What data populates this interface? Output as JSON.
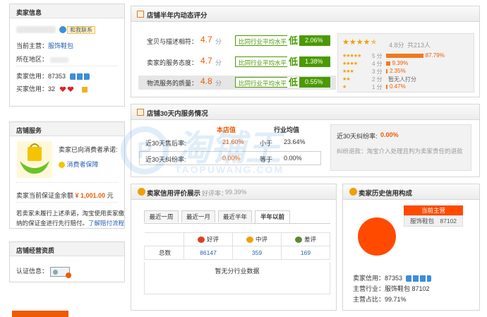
{
  "left": {
    "seller_info": {
      "title": "卖家信息",
      "contact_button": "和我联系",
      "main_business_label": "当前主营：",
      "main_business_value": "服饰鞋包",
      "location_label": "所在地区：",
      "seller_credit_label": "卖家信用：",
      "seller_credit_value": "87353",
      "buyer_credit_label": "买家信用：",
      "buyer_credit_value": "32"
    },
    "shop_service": {
      "title": "店铺服务",
      "promise_text": "卖家已向消费者承诺:",
      "guarantee_link": "消费者保障",
      "deposit_label": "卖家当前保证金余额",
      "deposit_value": "¥ 1,001.00",
      "deposit_unit": "元",
      "note_line1": "若卖家未履行上述承诺，淘宝使用卖家缴",
      "note_line2": "纳的保证金进行先行赔付。",
      "note_link": "了解赔付流程"
    },
    "qualification": {
      "title": "店铺经营资质",
      "cert_label": "认证信息："
    }
  },
  "dsr": {
    "title": "店铺半年内动态评分",
    "rows": [
      {
        "label": "宝贝与描述相符：",
        "score": "4.7",
        "unit": "分",
        "compare_label": "比同行业平均水平",
        "low": "低",
        "pct": "2.06%"
      },
      {
        "label": "卖家的服务态度：",
        "score": "4.7",
        "unit": "分",
        "compare_label": "比同行业平均水平",
        "low": "低",
        "pct": "1.38%"
      },
      {
        "label": "物流服务的质量：",
        "score": "4.8",
        "unit": "分",
        "compare_label": "比同行业平均水平",
        "low": "低",
        "pct": "0.55%"
      }
    ],
    "summary": {
      "score": "4.8分",
      "count": "共213人",
      "distribution": [
        {
          "label": "5 分",
          "pct": "87.79%",
          "fraction": 0.8779
        },
        {
          "label": "4 分",
          "pct": "9.39%",
          "fraction": 0.0939
        },
        {
          "label": "3 分",
          "pct": "2.35%",
          "fraction": 0.0235
        },
        {
          "label": "2 分",
          "pct": "暂无人打分",
          "fraction": 0
        },
        {
          "label": "1 分",
          "pct": "0.47%",
          "fraction": 0.0047
        }
      ]
    }
  },
  "service30": {
    "title": "店铺30天内服务情况",
    "col_shop": "本店值",
    "col_avg": "行业均值",
    "rows": [
      {
        "label": "近30天售后率:",
        "shop": "21.60%",
        "cmp": "小于",
        "avg": "23.64%"
      },
      {
        "label": "近30天纠纷率:",
        "shop": "0.00%",
        "cmp": "等于",
        "avg": "0.00%"
      }
    ],
    "dispute_title": "近30天纠纷率:",
    "dispute_value": "0.00%",
    "dispute_desc": "纠纷退款：淘宝介入处理且判为卖家责任的退款"
  },
  "credit": {
    "title": "卖家信用评价展示",
    "good_rate_label": "好评率：",
    "good_rate": "99.39%",
    "tabs": [
      "最近一周",
      "最近一月",
      "最近半年",
      "半年以前"
    ],
    "active_tab": 3,
    "headers": [
      "好评",
      "中评",
      "差评"
    ],
    "total_label": "总数",
    "totals": [
      "86147",
      "359",
      "169"
    ],
    "no_data": "暂无分行业数据"
  },
  "history": {
    "title": "卖家历史信用构成",
    "current_main": "当前主营",
    "category": "服饰鞋包",
    "category_value": "87102",
    "seller_credit_label": "卖家信用：",
    "seller_credit_value": "87353",
    "main_industry_label": "主营行业：",
    "main_industry_value": "服饰鞋包 87102",
    "main_ratio_label": "主营占比：",
    "main_ratio_value": "99.71%",
    "pie_fraction": 0.9971
  },
  "watermark": {
    "brand": "淘铺王",
    "url": "TAOPUWANG.COM"
  },
  "colors": {
    "accent": "#f05a00",
    "green": "#4a9a00",
    "link": "#2b63b6",
    "pie": "#ff4a00"
  }
}
